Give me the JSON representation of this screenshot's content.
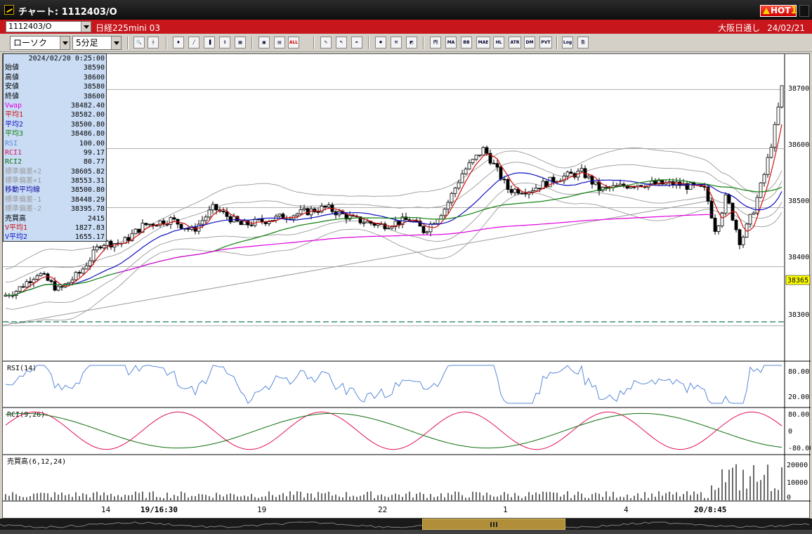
{
  "window": {
    "title": "チャート: 1112403/O",
    "hot_label": "HOT",
    "hot_number": "1"
  },
  "symbol_bar": {
    "symbol": "1112403/O",
    "name": "日経225mini 03",
    "session": "大阪日通し",
    "date": "24/02/21"
  },
  "toolbar": {
    "chart_type": "ローソク",
    "interval": "5分足",
    "buttons": [
      "zoom",
      "crosshair",
      "candle",
      "line",
      "bar",
      "trend",
      "grid",
      "mark",
      "info",
      "all",
      "draw",
      "pointer",
      "pen",
      "fib",
      "wrench",
      "color",
      "ichimoku",
      "MA",
      "BB",
      "MAE",
      "HL",
      "ATR",
      "DMI",
      "PVT",
      "Log",
      "export"
    ],
    "button_labels": {
      "all": "ALL",
      "ma": "MA",
      "bb": "BB",
      "mae": "MAE",
      "hl": "HL",
      "atr": "ATR",
      "dmi": "DM\nI",
      "pvt": "PVT",
      "log": "Log"
    }
  },
  "info_panel": {
    "datetime": "2024/02/20  0:25:00",
    "rows": [
      {
        "key": "始値",
        "value": "38590",
        "color": "#000000"
      },
      {
        "key": "高値",
        "value": "38600",
        "color": "#000000"
      },
      {
        "key": "安値",
        "value": "38580",
        "color": "#000000"
      },
      {
        "key": "終値",
        "value": "38600",
        "color": "#000000"
      },
      {
        "key": "Vwap",
        "value": "38482.40",
        "color": "#e000e0"
      },
      {
        "key": "平均1",
        "value": "38582.00",
        "color": "#d01010"
      },
      {
        "key": "平均2",
        "value": "38500.80",
        "color": "#1010c0"
      },
      {
        "key": "平均3",
        "value": "38486.80",
        "color": "#108010"
      },
      {
        "key": "RSI",
        "value": "100.00",
        "color": "#5a8ad8"
      },
      {
        "key": "RCI1",
        "value": "99.17",
        "color": "#e0105a"
      },
      {
        "key": "RCI2",
        "value": "80.77",
        "color": "#107010"
      },
      {
        "key": "標準偏差+2",
        "value": "38605.82",
        "color": "#9a9a9a"
      },
      {
        "key": "標準偏差+1",
        "value": "38553.31",
        "color": "#9a9a9a"
      },
      {
        "key": "移動平均線",
        "value": "38500.80",
        "color": "#1010a0"
      },
      {
        "key": "標準偏差-1",
        "value": "38448.29",
        "color": "#9a9a9a"
      },
      {
        "key": "標準偏差-2",
        "value": "38395.78",
        "color": "#9a9a9a"
      },
      {
        "key": "売買高",
        "value": "2415",
        "color": "#000000"
      },
      {
        "key": "V平均1",
        "value": "1827.83",
        "color": "#d01010"
      },
      {
        "key": "V平均2",
        "value": "1655.17",
        "color": "#1010c0"
      }
    ]
  },
  "price_axis": {
    "ticks": [
      "38700",
      "38600",
      "38500",
      "38400",
      "38300"
    ],
    "current_price": "38365"
  },
  "panels": {
    "rsi": {
      "label": "RSI(14)",
      "ticks": [
        "80.00",
        "20.00"
      ]
    },
    "rci": {
      "label": "RCI(9,26)",
      "ticks": [
        "80.00",
        "0",
        "-80.00"
      ]
    },
    "volume": {
      "label": "売買高(6,12,24)",
      "ticks": [
        "20000",
        "10000",
        "0"
      ]
    }
  },
  "time_axis": {
    "labels": [
      "14",
      "19/16:30",
      "19",
      "22",
      "1",
      "4",
      "20/8:45"
    ]
  },
  "chart_data": {
    "type": "candlestick",
    "symbol": "1112403/O",
    "interval": "5分足",
    "price_range": [
      38240,
      38760
    ],
    "price_ticks": [
      38700,
      38600,
      38500,
      38400,
      38300
    ],
    "current_price": 38365,
    "price_path": [
      {
        "x": 0,
        "price": 38350
      },
      {
        "x": 20,
        "price": 38360
      },
      {
        "x": 50,
        "price": 38390
      },
      {
        "x": 80,
        "price": 38360
      },
      {
        "x": 110,
        "price": 38390
      },
      {
        "x": 140,
        "price": 38440
      },
      {
        "x": 170,
        "price": 38440
      },
      {
        "x": 200,
        "price": 38470
      },
      {
        "x": 240,
        "price": 38480
      },
      {
        "x": 270,
        "price": 38460
      },
      {
        "x": 300,
        "price": 38500
      },
      {
        "x": 340,
        "price": 38470
      },
      {
        "x": 380,
        "price": 38480
      },
      {
        "x": 420,
        "price": 38490
      },
      {
        "x": 460,
        "price": 38500
      },
      {
        "x": 500,
        "price": 38480
      },
      {
        "x": 540,
        "price": 38470
      },
      {
        "x": 580,
        "price": 38480
      },
      {
        "x": 600,
        "price": 38460
      },
      {
        "x": 630,
        "price": 38500
      },
      {
        "x": 655,
        "price": 38560
      },
      {
        "x": 685,
        "price": 38600
      },
      {
        "x": 700,
        "price": 38570
      },
      {
        "x": 720,
        "price": 38530
      },
      {
        "x": 750,
        "price": 38530
      },
      {
        "x": 790,
        "price": 38550
      },
      {
        "x": 825,
        "price": 38560
      },
      {
        "x": 850,
        "price": 38530
      },
      {
        "x": 900,
        "price": 38540
      },
      {
        "x": 960,
        "price": 38540
      },
      {
        "x": 1000,
        "price": 38530
      },
      {
        "x": 1015,
        "price": 38460
      },
      {
        "x": 1030,
        "price": 38520
      },
      {
        "x": 1050,
        "price": 38440
      },
      {
        "x": 1070,
        "price": 38500
      },
      {
        "x": 1085,
        "price": 38560
      },
      {
        "x": 1100,
        "price": 38640
      },
      {
        "x": 1110,
        "price": 38710
      },
      {
        "x": 1115,
        "price": 38720
      }
    ],
    "series": [
      {
        "name": "平均1",
        "color": "#d01010"
      },
      {
        "name": "平均2",
        "color": "#1010c0"
      },
      {
        "name": "平均3",
        "color": "#108010"
      },
      {
        "name": "Vwap",
        "color": "#e000e0"
      },
      {
        "name": "標準偏差±1/±2",
        "color": "#9a9a9a"
      },
      {
        "name": "RSI(14)",
        "color": "#5a8ad8"
      },
      {
        "name": "RCI1",
        "color": "#e0105a"
      },
      {
        "name": "RCI2",
        "color": "#107010"
      }
    ],
    "xlabels": [
      "14",
      "19/16:30",
      "19",
      "22",
      "1",
      "4",
      "20/8:45"
    ]
  }
}
